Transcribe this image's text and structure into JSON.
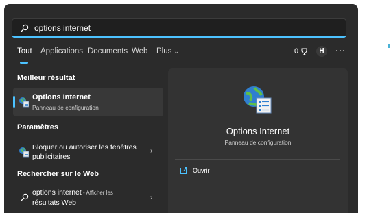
{
  "search": {
    "value": "options internet"
  },
  "tabs": [
    {
      "label": "Tout"
    },
    {
      "label": "Applications"
    },
    {
      "label": "Documents"
    },
    {
      "label": "Web"
    },
    {
      "label": "Plus"
    }
  ],
  "toolbar": {
    "count": "0",
    "avatar_initial": "H",
    "more_label": "···"
  },
  "best_match": {
    "section_label": "Meilleur résultat",
    "title": "Options Internet",
    "subtitle": "Panneau de configuration"
  },
  "settings": {
    "section_label": "Paramètres",
    "item_line1": "Bloquer ou autoriser les fenêtres",
    "item_line2": "publicitaires"
  },
  "web": {
    "section_label": "Rechercher sur le Web",
    "query": "options internet",
    "suffix": " - Afficher les",
    "line2": "résultats Web"
  },
  "preview": {
    "title": "Options Internet",
    "subtitle": "Panneau de configuration",
    "action_label": "Ouvrir"
  },
  "colors": {
    "accent": "#4cc2ff",
    "panel": "#2b2b2b",
    "preview": "#333333"
  }
}
